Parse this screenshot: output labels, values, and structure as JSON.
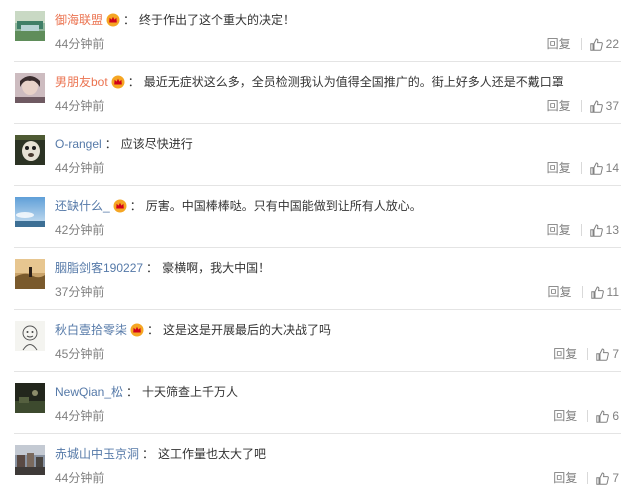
{
  "labels": {
    "reply": "回复",
    "separator": "："
  },
  "colors": {
    "username": "#eb7350",
    "username_alt": "#5579a8",
    "content": "#333333",
    "meta": "#808080",
    "divider": "#e4e4e4",
    "vip_badge": "#f5a623"
  },
  "comments": [
    {
      "username": "御海联盟",
      "vip": true,
      "text": "终于作出了这个重大的决定！",
      "time": "44分钟前",
      "likes": "22",
      "avatar_icon": "landscape-avatar-icon"
    },
    {
      "username": "男朋友bot",
      "vip": true,
      "text": "最近无症状这么多，全员检测我认为值得全国推广的。街上好多人还是不戴口罩",
      "time": "44分钟前",
      "likes": "37",
      "avatar_icon": "portrait-avatar-icon"
    },
    {
      "username": "O-rangel",
      "vip": false,
      "text": "应该尽快进行",
      "time": "44分钟前",
      "likes": "14",
      "avatar_icon": "dog-avatar-icon"
    },
    {
      "username": "还缺什么_",
      "vip": true,
      "text": "厉害。中国棒棒哒。只有中国能做到让所有人放心。",
      "time": "42分钟前",
      "likes": "13",
      "avatar_icon": "sky-avatar-icon"
    },
    {
      "username": "胭脂剑客190227",
      "vip": false,
      "text": "豪横啊，我大中国！",
      "time": "37分钟前",
      "likes": "11",
      "avatar_icon": "desert-avatar-icon"
    },
    {
      "username": "秋白壹拾零柒",
      "vip": true,
      "text": "这是这是开展最后的大决战了吗",
      "time": "45分钟前",
      "likes": "7",
      "avatar_icon": "sketch-avatar-icon"
    },
    {
      "username": "NewQian_松",
      "vip": false,
      "text": "十天筛查上千万人",
      "time": "44分钟前",
      "likes": "6",
      "avatar_icon": "dark-avatar-icon"
    },
    {
      "username": "赤城山中玉京洞",
      "vip": false,
      "text": "这工作量也太大了吧",
      "time": "44分钟前",
      "likes": "7",
      "avatar_icon": "street-avatar-icon"
    }
  ]
}
